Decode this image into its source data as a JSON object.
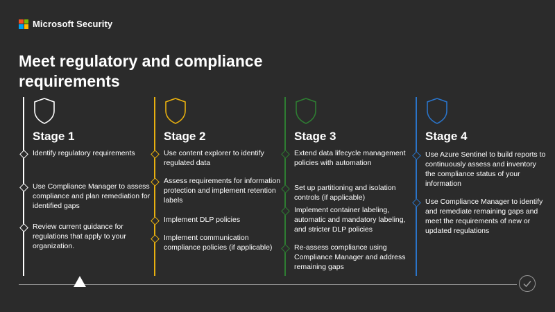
{
  "brand": {
    "name": "Microsoft Security",
    "logo_colors": [
      "#f25022",
      "#7fba00",
      "#00a4ef",
      "#ffb900"
    ]
  },
  "title": "Meet regulatory and compliance requirements",
  "colors": {
    "stage1": "#ffffff",
    "stage2": "#e8b00f",
    "stage3": "#2e7d32",
    "stage4": "#2a74c9",
    "baseline": "#9a9a9a",
    "background": "#2b2b2b"
  },
  "stages": [
    {
      "title": "Stage 1",
      "icon": "shield-icon",
      "items": [
        "Identify regulatory requirements",
        "Use Compliance Manager to assess compliance and plan remediation for identified gaps",
        "Review current guidance for regulations that apply to your organization."
      ]
    },
    {
      "title": "Stage 2",
      "icon": "shield-icon",
      "items": [
        "Use content explorer to identify regulated data",
        "Assess requirements for information protection and implement retention labels",
        "Implement DLP policies",
        "Implement communication compliance policies (if applicable)"
      ]
    },
    {
      "title": "Stage 3",
      "icon": "shield-icon",
      "items": [
        "Extend data lifecycle management policies with automation",
        "Set up partitioning and isolation controls (if applicable)",
        "Implement container labeling, automatic and mandatory labeling, and stricter DLP policies",
        "Re-assess compliance using Compliance Manager and address remaining gaps"
      ]
    },
    {
      "title": "Stage 4",
      "icon": "shield-icon",
      "items": [
        "Use Azure Sentinel to build reports to continuously assess and inventory the compliance status of your information",
        "Use Compliance Manager to identify and remediate remaining gaps and meet the requirements of new or updated regulations"
      ]
    }
  ]
}
